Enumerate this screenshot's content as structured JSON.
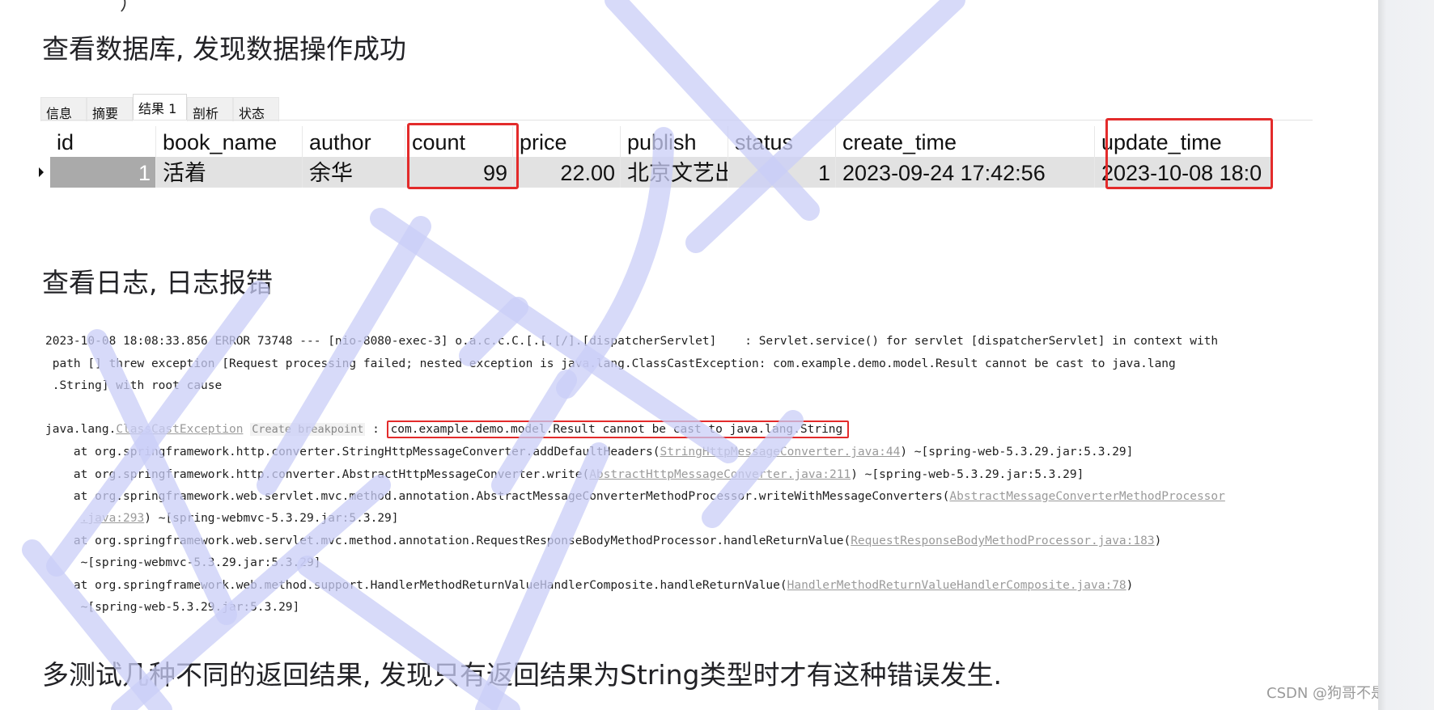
{
  "headings": {
    "db_check": "查看数据库, 发现数据操作成功",
    "log_check": "查看日志, 日志报错",
    "conclusion": "多测试几种不同的返回结果, 发现只有返回结果为String类型时才有这种错误发生."
  },
  "top_partial_glyph": "）",
  "db_result": {
    "tabs": [
      {
        "label": "信息",
        "active": false
      },
      {
        "label": "摘要",
        "active": false
      },
      {
        "label": "结果 1",
        "active": true
      },
      {
        "label": "剖析",
        "active": false
      },
      {
        "label": "状态",
        "active": false
      }
    ],
    "columns": [
      "id",
      "book_name",
      "author",
      "count",
      "price",
      "publish",
      "status",
      "create_time",
      "update_time"
    ],
    "rows": [
      [
        "1",
        "活着",
        "余华",
        "99",
        "22.00",
        "北京文艺出",
        "1",
        "2023-09-24 17:42:56",
        "2023-10-08 18:0"
      ]
    ],
    "highlighted_columns": [
      "count",
      "update_time"
    ]
  },
  "log": {
    "line1": "2023-10-08 18:08:33.856 ERROR 73748 --- [nio-8080-exec-3] o.a.c.c.C.[.[.[/].[dispatcherServlet]    : Servlet.service() for servlet [dispatcherServlet] in context with",
    "line2": " path [] threw exception [Request processing failed; nested exception is java.lang.ClassCastException: com.example.demo.model.Result cannot be cast to java.lang",
    "line3": " .String] with root cause",
    "exception_prefix": "java.lang.",
    "exception_class": "ClassCastException",
    "create_breakpoint_hint": "Create breakpoint",
    "exception_sep": " : ",
    "exception_message": "com.example.demo.model.Result cannot be cast to java.lang.String",
    "frames": [
      {
        "at": "    at org.springframework.http.converter.StringHttpMessageConverter.addDefaultHeaders(",
        "link": "StringHttpMessageConverter.java:44",
        "tail": ") ~[spring-web-5.3.29.jar:5.3.29]"
      },
      {
        "at": "    at org.springframework.http.converter.AbstractHttpMessageConverter.write(",
        "link": "AbstractHttpMessageConverter.java:211",
        "tail": ") ~[spring-web-5.3.29.jar:5.3.29]"
      },
      {
        "at": "    at org.springframework.web.servlet.mvc.method.annotation.AbstractMessageConverterMethodProcessor.writeWithMessageConverters(",
        "link": "AbstractMessageConverterMethodProcessor",
        "link2": ".java:293",
        "tail": ") ~[spring-webmvc-5.3.29.jar:5.3.29]"
      },
      {
        "at": "    at org.springframework.web.servlet.mvc.method.annotation.RequestResponseBodyMethodProcessor.handleReturnValue(",
        "link": "RequestResponseBodyMethodProcessor.java:183",
        "tail": ")",
        "cont": "     ~[spring-webmvc-5.3.29.jar:5.3.29]"
      },
      {
        "at": "    at org.springframework.web.method.support.HandlerMethodReturnValueHandlerComposite.handleReturnValue(",
        "link": "HandlerMethodReturnValueHandlerComposite.java:78",
        "tail": ")",
        "cont": "     ~[spring-web-5.3.29.jar:5.3.29]"
      }
    ]
  },
  "watermark": "CSDN @狗哥不是甜妹",
  "colors": {
    "highlight_red": "#e32b2b",
    "link_gray": "#9a9a9a",
    "watermark_blue": "#c9cdf7"
  }
}
